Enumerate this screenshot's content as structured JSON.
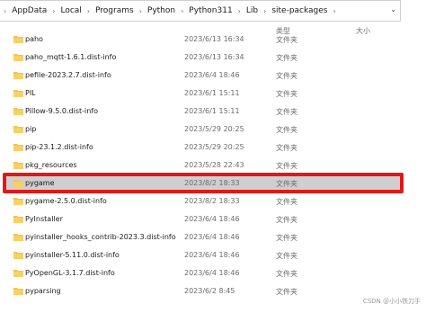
{
  "address_bar": {
    "crumbs": [
      "AppData",
      "Local",
      "Programs",
      "Python",
      "Python311",
      "Lib",
      "site-packages"
    ]
  },
  "columns": {
    "type": "类型",
    "size": "大小"
  },
  "files": [
    {
      "name": "paho",
      "date": "2023/6/13 16:34",
      "type": "文件夹"
    },
    {
      "name": "paho_mqtt-1.6.1.dist-info",
      "date": "2023/6/13 16:34",
      "type": "文件夹"
    },
    {
      "name": "pefile-2023.2.7.dist-info",
      "date": "2023/6/4 18:46",
      "type": "文件夹"
    },
    {
      "name": "PIL",
      "date": "2023/6/1 15:11",
      "type": "文件夹"
    },
    {
      "name": "Pillow-9.5.0.dist-info",
      "date": "2023/6/1 15:11",
      "type": "文件夹"
    },
    {
      "name": "pip",
      "date": "2023/5/29 20:25",
      "type": "文件夹"
    },
    {
      "name": "pip-23.1.2.dist-info",
      "date": "2023/5/29 20:25",
      "type": "文件夹"
    },
    {
      "name": "pkg_resources",
      "date": "2023/5/28 22:43",
      "type": "文件夹"
    },
    {
      "name": "pygame",
      "date": "2023/8/2 18:33",
      "type": "文件夹",
      "selected": true
    },
    {
      "name": "pygame-2.5.0.dist-info",
      "date": "2023/8/2 18:33",
      "type": "文件夹"
    },
    {
      "name": "PyInstaller",
      "date": "2023/6/4 18:46",
      "type": "文件夹"
    },
    {
      "name": "pyinstaller_hooks_contrib-2023.3.dist-info",
      "date": "2023/6/4 18:46",
      "type": "文件夹"
    },
    {
      "name": "pyinstaller-5.11.0.dist-info",
      "date": "2023/6/4 18:46",
      "type": "文件夹"
    },
    {
      "name": "PyOpenGL-3.1.7.dist-info",
      "date": "2023/6/4 18:46",
      "type": "文件夹"
    },
    {
      "name": "pyparsing",
      "date": "2023/6/2 8:45",
      "type": "文件夹"
    }
  ],
  "watermark": "CSDN @小小铁刀手",
  "colors": {
    "folder": "#f3c24e",
    "selection": "#cfcfcf",
    "highlight_border": "#e11818"
  }
}
